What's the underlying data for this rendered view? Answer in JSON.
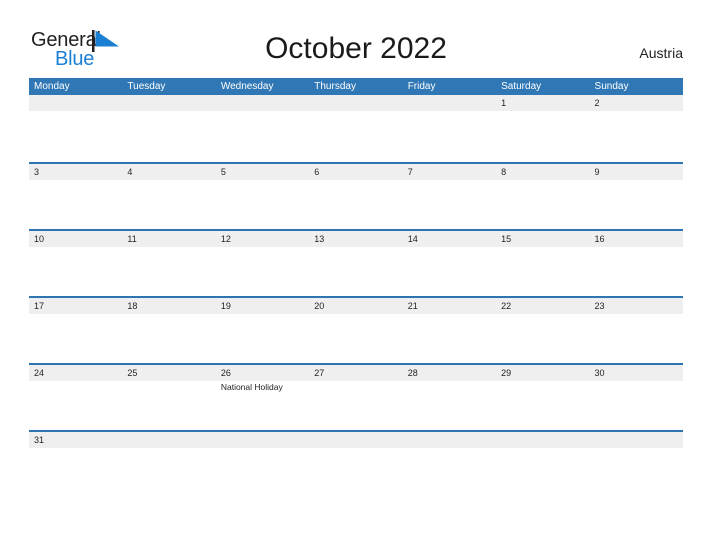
{
  "branding": {
    "logo_text_primary": "General",
    "logo_text_secondary": "Blue",
    "logo_icon": "flag-triangle-icon",
    "primary_color": "#1b7fd4"
  },
  "header": {
    "title": "October 2022",
    "country": "Austria"
  },
  "theme": {
    "header_bar_color": "#3077b5",
    "row_divider_color": "#2e74b0",
    "band_color": "#efefef",
    "text_color": "#231f20"
  },
  "calendar": {
    "weekdays": [
      "Monday",
      "Tuesday",
      "Wednesday",
      "Thursday",
      "Friday",
      "Saturday",
      "Sunday"
    ],
    "weeks": [
      [
        {
          "day": ""
        },
        {
          "day": ""
        },
        {
          "day": ""
        },
        {
          "day": ""
        },
        {
          "day": ""
        },
        {
          "day": "1"
        },
        {
          "day": "2"
        }
      ],
      [
        {
          "day": "3"
        },
        {
          "day": "4"
        },
        {
          "day": "5"
        },
        {
          "day": "6"
        },
        {
          "day": "7"
        },
        {
          "day": "8"
        },
        {
          "day": "9"
        }
      ],
      [
        {
          "day": "10"
        },
        {
          "day": "11"
        },
        {
          "day": "12"
        },
        {
          "day": "13"
        },
        {
          "day": "14"
        },
        {
          "day": "15"
        },
        {
          "day": "16"
        }
      ],
      [
        {
          "day": "17"
        },
        {
          "day": "18"
        },
        {
          "day": "19"
        },
        {
          "day": "20"
        },
        {
          "day": "21"
        },
        {
          "day": "22"
        },
        {
          "day": "23"
        }
      ],
      [
        {
          "day": "24"
        },
        {
          "day": "25"
        },
        {
          "day": "26",
          "event": "National Holiday"
        },
        {
          "day": "27"
        },
        {
          "day": "28"
        },
        {
          "day": "29"
        },
        {
          "day": "30"
        }
      ],
      [
        {
          "day": "31"
        },
        {
          "day": ""
        },
        {
          "day": ""
        },
        {
          "day": ""
        },
        {
          "day": ""
        },
        {
          "day": ""
        },
        {
          "day": ""
        }
      ]
    ]
  }
}
